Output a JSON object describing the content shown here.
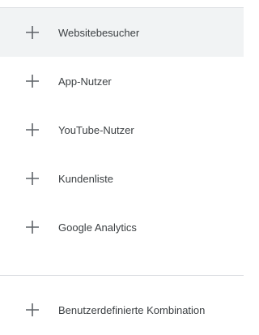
{
  "menu": {
    "items": [
      {
        "label": "Websitebesucher",
        "icon": "plus-icon"
      },
      {
        "label": "App-Nutzer",
        "icon": "plus-icon"
      },
      {
        "label": "YouTube-Nutzer",
        "icon": "plus-icon"
      },
      {
        "label": "Kundenliste",
        "icon": "plus-icon"
      },
      {
        "label": "Google Analytics",
        "icon": "plus-icon"
      }
    ],
    "custom": {
      "label": "Benutzerdefinierte Kombination",
      "icon": "plus-icon"
    }
  },
  "colors": {
    "highlight_bg": "#f1f3f4",
    "text": "#3c4043",
    "icon": "#5f6368",
    "divider": "#dadce0"
  }
}
